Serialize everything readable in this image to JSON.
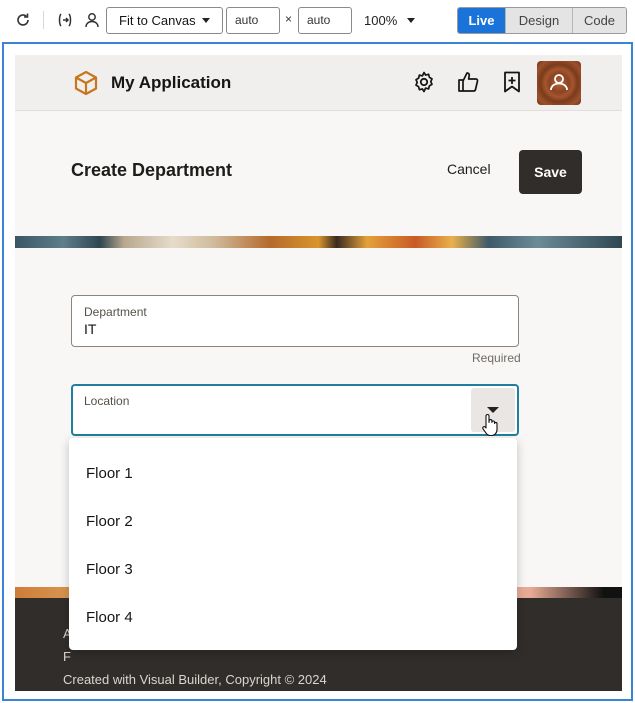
{
  "toolbar": {
    "fit_label": "Fit to Canvas",
    "width_value": "auto",
    "height_value": "auto",
    "times": "×",
    "zoom": "100%",
    "modes": [
      "Live",
      "Design",
      "Code"
    ]
  },
  "app": {
    "title": "My Application",
    "page_title": "Create Department",
    "cancel_label": "Cancel",
    "save_label": "Save",
    "department": {
      "label": "Department",
      "value": "IT",
      "helper": "Required"
    },
    "location": {
      "label": "Location",
      "value": ""
    },
    "location_options": [
      "Floor 1",
      "Floor 2",
      "Floor 3",
      "Floor 4"
    ],
    "footer": {
      "line1_visible": "A",
      "line2_visible": "F",
      "copyright": "Created with Visual Builder, Copyright © 2024"
    }
  },
  "colors": {
    "accent": "#1a73d9",
    "save_button": "#312d2a",
    "focus_border": "#227e9e",
    "logo": "#c7761e"
  },
  "icons": [
    "refresh-icon",
    "variables-icon",
    "user-icon",
    "logo-cube-icon",
    "gear-icon",
    "thumbs-up-icon",
    "bookmark-add-icon",
    "avatar",
    "chevron-down-icon",
    "hand-cursor-icon"
  ]
}
